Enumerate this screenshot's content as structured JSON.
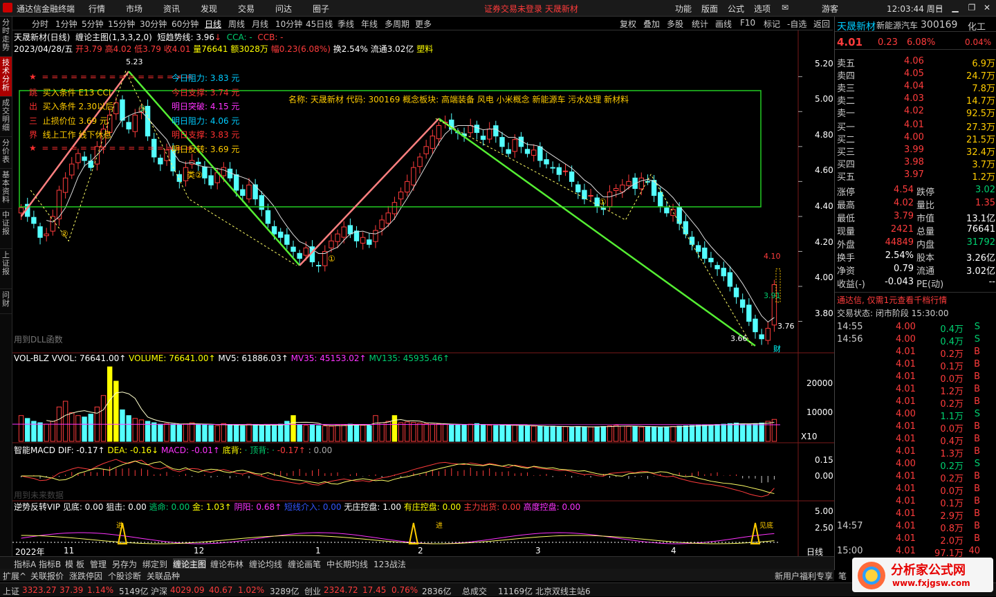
{
  "menubar": {
    "app_title": "通达信金融终端",
    "menus": [
      "行情",
      "市场",
      "资讯",
      "发现",
      "交易",
      "问达",
      "圈子"
    ],
    "notice": "证券交易未登录  天晟新材",
    "right_menus": [
      "功能",
      "版面",
      "公式",
      "选项"
    ],
    "user": "游客",
    "clock": "12:03:44 周日"
  },
  "left_tabs": [
    "分时走势",
    "技术分析",
    "成交明细",
    "分价表",
    "基本资料",
    "中证报",
    "上证报",
    "问财"
  ],
  "period_bar": {
    "periods": [
      "分时",
      "1分钟",
      "5分钟",
      "15分钟",
      "30分钟",
      "60分钟",
      "日线",
      "周线",
      "月线",
      "10分钟",
      "45日线",
      "季线",
      "年线",
      "多周期",
      "更多"
    ],
    "selected": "日线",
    "tools": [
      "复权",
      "叠加",
      "多股",
      "统计",
      "画线",
      "F10",
      "标记",
      "-自选",
      "返回"
    ]
  },
  "chart_header": {
    "line1": {
      "name": "天晟新材(日线)",
      "formula": "缠论主图(1,3,3,2,0)",
      "trend_label": "短趋势线: 3.96",
      "trend_arrow": "↓",
      "cca": "CCA: -",
      "ccb": "CCB: -"
    },
    "line2": {
      "date": "2023/04/28/五",
      "open": "开3.79",
      "high": "高4.02",
      "low": "低3.79",
      "close": "收4.01",
      "vol": "量76641",
      "amount": "额3028万",
      "range": "幅0.23(6.08%)",
      "turnover": "换2.54%",
      "float": "流通3.02亿",
      "concept": "塑料"
    }
  },
  "annot": {
    "left_rows": [
      {
        "t1": "★",
        "t2": "= = = = = = = = = = = = = = = =",
        "c": "#ff3030"
      },
      {
        "t1": "跳",
        "t2": "买入条件 E13 CCI",
        "c": "#ffcc00"
      },
      {
        "t1": "出",
        "t2": "买入条件 2.30以后",
        "c": "#ffcc00"
      },
      {
        "t1": "三",
        "t2": "止损价位 3.69 元",
        "c": "#ffcc00"
      },
      {
        "t1": "界",
        "t2": "线上工作 线下休息",
        "c": "#ffcc00"
      },
      {
        "t1": "★",
        "t2": "= = = = = = = = = = = = = = = =",
        "c": "#ff3030"
      }
    ],
    "levels": [
      {
        "label": "今日阻力:",
        "value": "3.83 元",
        "lc": "#00ccff",
        "vc": "#00ccff"
      },
      {
        "label": "今日支撑:",
        "value": "3.74 元",
        "lc": "#ff3030",
        "vc": "#ff3030"
      },
      {
        "label": "明日突破:",
        "value": "4.15 元",
        "lc": "#ff33ff",
        "vc": "#ff33ff"
      },
      {
        "label": "明日阻力:",
        "value": "4.06 元",
        "lc": "#00ccff",
        "vc": "#00ccff"
      },
      {
        "label": "明日支撑:",
        "value": "3.83 元",
        "lc": "#ff3030",
        "vc": "#ff3030"
      },
      {
        "label": "明日反转:",
        "value": "3.69 元",
        "lc": "#ffcc00",
        "vc": "#ffcc00"
      }
    ],
    "concept_box": "名称: 天晟新材 代码: 300169 概念板块: 高端装备 风电 小米概念 新能源车 污水处理 新材料",
    "dll_text": "用到DLL函数",
    "price_marks": {
      "high": "5.23",
      "low": "3.66",
      "last": "3.76",
      "mark1": "4.10",
      "mark2": "3.91"
    },
    "wave_labels": [
      "①",
      "②",
      "③",
      "②",
      "①",
      "类②",
      "①"
    ],
    "fin_label": "财"
  },
  "price_axis": [
    "5.20",
    "5.00",
    "4.80",
    "4.60",
    "4.40",
    "4.20",
    "4.00",
    "3.80"
  ],
  "vol_panel": {
    "label": "VOL-BLZ",
    "vvol": "VVOL: 76641.00↑",
    "volume": "VOLUME: 76641.00↑",
    "mv5": "MV5: 61886.03↑",
    "mv35": "MV35: 45153.02↑",
    "mv135": "MV135: 45935.46↑",
    "axis": [
      "20000",
      "10000",
      "X10"
    ]
  },
  "macd_panel": {
    "label": "智能MACD",
    "dif": "DIF: -0.17↑",
    "dea": "DEA: -0.16↓",
    "macd": "MACD: -0.01↑",
    "bottom": "底背:",
    "top": "· 顶背: ·",
    "v1": "-0.17↑",
    "v2": ": 0.00",
    "axis": [
      "0.15",
      "0.00"
    ],
    "foot": "用到未来数据"
  },
  "vip_panel": {
    "label": "逆势反转VIP",
    "items": [
      "见底: 0.00",
      "狙击: 0.00",
      "逃命: 0.00",
      "金: 1.03↑",
      "阴阳: 0.68↑",
      "短线介入: 0.00",
      "无庄控盘: 1.00",
      "有庄控盘: 0.00",
      "主力出货: 0.00",
      "高度控盘: 0.00"
    ],
    "axis": [
      "5.00",
      "2.50"
    ],
    "tags": [
      "进",
      "进",
      "见底"
    ]
  },
  "date_axis": [
    "2022年",
    "11",
    "12",
    "1",
    "2",
    "3",
    "4"
  ],
  "date_axis_right": "日线",
  "bottom_tabs": [
    "指标A",
    "指标B",
    "模",
    "板",
    "管理",
    "另存为",
    "绑定到",
    "缠论主图",
    "缠论布林",
    "缠论均线",
    "缠论画笔",
    "中长期均线",
    "123战法"
  ],
  "bottom_tabs2": [
    "扩展^",
    "关联报价",
    "涨跌停因",
    "个股诊断",
    "关联品种"
  ],
  "quote": {
    "name": "天晟新材",
    "sector": "新能源汽车",
    "code": "300169",
    "chem": "化工",
    "price": "4.01",
    "change": "0.23",
    "pct": "6.08%",
    "chem_pct": "0.04%",
    "asks": [
      {
        "l": "卖五",
        "p": "4.06",
        "v": "6.9万"
      },
      {
        "l": "卖四",
        "p": "4.05",
        "v": "24.7万"
      },
      {
        "l": "卖三",
        "p": "4.04",
        "v": "7.8万"
      },
      {
        "l": "卖二",
        "p": "4.03",
        "v": "14.7万"
      },
      {
        "l": "卖一",
        "p": "4.02",
        "v": "92.5万"
      }
    ],
    "bids": [
      {
        "l": "买一",
        "p": "4.01",
        "v": "27.3万"
      },
      {
        "l": "买二",
        "p": "4.00",
        "v": "21.5万"
      },
      {
        "l": "买三",
        "p": "3.99",
        "v": "32.4万"
      },
      {
        "l": "买四",
        "p": "3.98",
        "v": "3.7万"
      },
      {
        "l": "买五",
        "p": "3.97",
        "v": "1.2万"
      }
    ],
    "stats": [
      {
        "a": "涨停",
        "av": "4.54",
        "avc": "#ff3c3c",
        "b": "跌停",
        "bv": "3.02",
        "bvc": "#00d070"
      },
      {
        "a": "最高",
        "av": "4.02",
        "avc": "#ff3c3c",
        "b": "量比",
        "bv": "1.35",
        "bvc": "#ff3c3c"
      },
      {
        "a": "最低",
        "av": "3.79",
        "avc": "#ff3c3c",
        "b": "市值",
        "bv": "13.1亿",
        "bvc": "#ffffff"
      },
      {
        "a": "现量",
        "av": "2421",
        "avc": "#ff3c3c",
        "b": "总量",
        "bv": "76641",
        "bvc": "#ffffff"
      },
      {
        "a": "外盘",
        "av": "44849",
        "avc": "#ff3c3c",
        "b": "内盘",
        "bv": "31792",
        "bvc": "#00d070"
      },
      {
        "a": "换手",
        "av": "2.54%",
        "avc": "#ffffff",
        "b": "股本",
        "bv": "3.26亿",
        "bvc": "#ffffff"
      },
      {
        "a": "净资",
        "av": "0.79",
        "avc": "#ffffff",
        "b": "流通",
        "bv": "3.02亿",
        "bvc": "#ffffff"
      },
      {
        "a": "收益(-)",
        "av": "-0.043",
        "avc": "#ffffff",
        "b": "PE(动)",
        "bv": "--",
        "bvc": "#ffffff"
      }
    ],
    "promo": "通达信, 仅需1元查看千档行情",
    "trade_state": "交易状态: 闭市阶段 15:30:00",
    "ticks": [
      {
        "t": "14:55",
        "p": "4.00",
        "v": "0.4万",
        "s": "S"
      },
      {
        "t": "14:56",
        "p": "4.00",
        "v": "0.4万",
        "s": "S"
      },
      {
        "t": "",
        "p": "4.01",
        "v": "0.2万",
        "s": "B"
      },
      {
        "t": "",
        "p": "4.01",
        "v": "0.1万",
        "s": "B"
      },
      {
        "t": "",
        "p": "4.01",
        "v": "0.0万",
        "s": "B"
      },
      {
        "t": "",
        "p": "4.01",
        "v": "1.2万",
        "s": "B"
      },
      {
        "t": "",
        "p": "4.01",
        "v": "0.2万",
        "s": "B"
      },
      {
        "t": "",
        "p": "4.00",
        "v": "1.1万",
        "s": "S"
      },
      {
        "t": "",
        "p": "4.01",
        "v": "0.0万",
        "s": "B"
      },
      {
        "t": "",
        "p": "4.01",
        "v": "0.4万",
        "s": "B"
      },
      {
        "t": "",
        "p": "4.01",
        "v": "1.3万",
        "s": "B"
      },
      {
        "t": "",
        "p": "4.00",
        "v": "0.2万",
        "s": "S"
      },
      {
        "t": "",
        "p": "4.01",
        "v": "0.2万",
        "s": "B"
      },
      {
        "t": "",
        "p": "4.01",
        "v": "0.0万",
        "s": "B"
      },
      {
        "t": "",
        "p": "4.01",
        "v": "0.1万",
        "s": "B"
      },
      {
        "t": "",
        "p": "4.01",
        "v": "2.9万",
        "s": "B"
      },
      {
        "t": "14:57",
        "p": "4.01",
        "v": "0.8万",
        "s": "B"
      },
      {
        "t": "",
        "p": "4.01",
        "v": "2.0万",
        "s": "B"
      },
      {
        "t": "15:00",
        "p": "4.01",
        "v": "97.1万",
        "s": "40"
      }
    ],
    "foot_tabs": [
      "新用户福利专享",
      "笔"
    ]
  },
  "statusbar": {
    "items": [
      {
        "l": "上证",
        "v": "3323.27",
        "c": "37.39",
        "p": "1.14%",
        "a": "5149亿"
      },
      {
        "l": "沪深",
        "v": "4029.09",
        "c": "40.67",
        "p": "1.02%",
        "a": "3289亿"
      },
      {
        "l": "创业",
        "v": "2324.72",
        "c": "17.45",
        "p": "0.76%",
        "a": "2836亿"
      }
    ],
    "total_label": "总成交",
    "total": "11169亿",
    "station": "北京双线主站6",
    "watermark_cn": "分析家公式网",
    "watermark_url": "www.fxjgsw.com"
  },
  "chart_data": {
    "type": "candlestick",
    "price_range": [
      3.62,
      5.29
    ],
    "closes": [
      4.45,
      4.4,
      4.36,
      4.28,
      4.3,
      4.4,
      4.55,
      4.62,
      4.7,
      4.76,
      4.72,
      4.68,
      4.8,
      4.9,
      4.98,
      5.05,
      4.95,
      4.9,
      4.98,
      5.02,
      4.86,
      4.74,
      4.7,
      4.78,
      4.66,
      4.6,
      4.68,
      4.72,
      4.7,
      4.62,
      4.58,
      4.65,
      4.68,
      4.62,
      4.55,
      4.52,
      4.58,
      4.5,
      4.44,
      4.36,
      4.3,
      4.28,
      4.24,
      4.2,
      4.16,
      4.22,
      4.14,
      4.12,
      4.2,
      4.26,
      4.3,
      4.34,
      4.3,
      4.26,
      4.28,
      4.24,
      4.32,
      4.38,
      4.42,
      4.48,
      4.54,
      4.6,
      4.68,
      4.74,
      4.8,
      4.86,
      4.92,
      4.94,
      4.9,
      4.88,
      4.86,
      4.92,
      4.88,
      4.84,
      4.9,
      4.86,
      4.8,
      4.76,
      4.84,
      4.8,
      4.76,
      4.78,
      4.72,
      4.7,
      4.68,
      4.64,
      4.66,
      4.6,
      4.54,
      4.5,
      4.52,
      4.46,
      4.44,
      4.54,
      4.56,
      4.58,
      4.6,
      4.56,
      4.62,
      4.6,
      4.52,
      4.46,
      4.42,
      4.44,
      4.36,
      4.3,
      4.24,
      4.2,
      4.16,
      4.14,
      4.1,
      4.06,
      4.0,
      3.94,
      3.88,
      3.8,
      3.74,
      3.7,
      3.76,
      4.01
    ],
    "volumes": [
      9000,
      8000,
      7000,
      6500,
      6000,
      7000,
      12000,
      14000,
      10000,
      9000,
      8500,
      9500,
      12000,
      16000,
      26000,
      21000,
      11000,
      9000,
      8000,
      7500,
      7000,
      6500,
      6000,
      6200,
      6000,
      5800,
      6100,
      6500,
      6000,
      5800,
      5600,
      5500,
      6200,
      5800,
      5600,
      5400,
      6000,
      5800,
      5600,
      5500,
      5400,
      6000,
      7000,
      9000,
      5800,
      5600,
      5700,
      5500,
      5400,
      5300,
      5600,
      5800,
      6000,
      5800,
      5600,
      5500,
      9000,
      6500,
      7000,
      9000,
      6500,
      6800,
      6600,
      6400,
      6200,
      6000,
      6100,
      6000,
      5900,
      5800,
      5700,
      6000,
      6200,
      5800,
      5600,
      5500,
      5600,
      5700,
      5600,
      5500,
      5400,
      5300,
      5200,
      5100,
      5300,
      5200,
      5100,
      5000,
      5200,
      5100,
      5000,
      5100,
      5200,
      5400,
      5600,
      5300,
      5200,
      5100,
      5000,
      5200,
      5100,
      5000,
      5100,
      5200,
      5300,
      5400,
      5500,
      5600,
      5700,
      5800,
      5900,
      6000,
      6200,
      6400,
      6100,
      6000,
      6200,
      6400,
      7000,
      7664
    ]
  }
}
